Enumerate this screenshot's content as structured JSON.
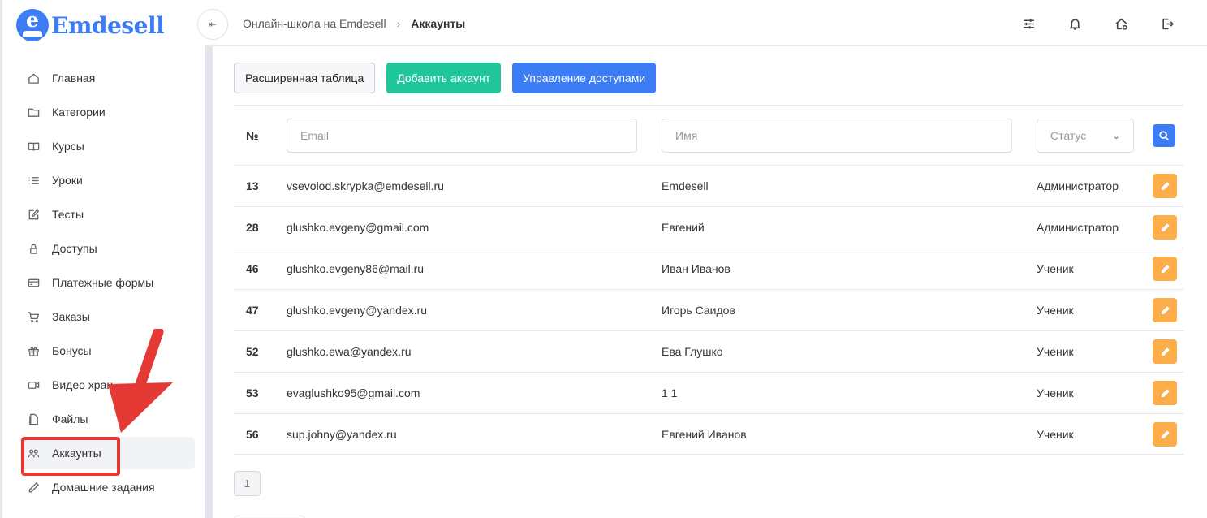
{
  "brand": {
    "name": "Emdesell",
    "accent": "#3d7cf5"
  },
  "sidebar": {
    "items": [
      {
        "label": "Главная",
        "icon": "home-icon"
      },
      {
        "label": "Категории",
        "icon": "folder-icon"
      },
      {
        "label": "Курсы",
        "icon": "book-icon"
      },
      {
        "label": "Уроки",
        "icon": "list-icon"
      },
      {
        "label": "Тесты",
        "icon": "edit-square-icon"
      },
      {
        "label": "Доступы",
        "icon": "lock-icon"
      },
      {
        "label": "Платежные формы",
        "icon": "credit-card-icon"
      },
      {
        "label": "Заказы",
        "icon": "cart-icon"
      },
      {
        "label": "Бонусы",
        "icon": "gift-icon"
      },
      {
        "label": "Видео хран",
        "icon": "video-icon"
      },
      {
        "label": "Файлы",
        "icon": "file-icon"
      },
      {
        "label": "Аккаунты",
        "icon": "users-icon"
      },
      {
        "label": "Домашние задания",
        "icon": "pencil-icon"
      }
    ],
    "active_index": 11
  },
  "header": {
    "breadcrumb": {
      "parent": "Онлайн-школа на Emdesell",
      "current": "Аккаунты"
    },
    "collapse_symbol": "⇤"
  },
  "toolbar": {
    "extended_table": "Расширенная таблица",
    "add_account": "Добавить аккаунт",
    "manage_access": "Управление доступами"
  },
  "filters": {
    "num_header": "№",
    "email_placeholder": "Email",
    "name_placeholder": "Имя",
    "status_placeholder": "Статус"
  },
  "accounts": [
    {
      "id": "13",
      "email": "vsevolod.skrypka@emdesell.ru",
      "name": "Emdesell",
      "status": "Администратор"
    },
    {
      "id": "28",
      "email": "glushko.evgeny@gmail.com",
      "name": "Евгений",
      "status": "Администратор"
    },
    {
      "id": "46",
      "email": "glushko.evgeny86@mail.ru",
      "name": "Иван Иванов",
      "status": "Ученик"
    },
    {
      "id": "47",
      "email": "glushko.evgeny@yandex.ru",
      "name": "Игорь Саидов",
      "status": "Ученик"
    },
    {
      "id": "52",
      "email": "glushko.ewa@yandex.ru",
      "name": "Ева Глушко",
      "status": "Ученик"
    },
    {
      "id": "53",
      "email": "evaglushko95@gmail.com",
      "name": "1 1",
      "status": "Ученик"
    },
    {
      "id": "56",
      "email": "sup.johny@yandex.ru",
      "name": "Евгений Иванов",
      "status": "Ученик"
    }
  ],
  "pagination": {
    "current_page": "1"
  },
  "colors": {
    "success": "#1ec69a",
    "primary": "#3c7cf5",
    "edit": "#fbae4a",
    "annotation": "#e53935"
  }
}
